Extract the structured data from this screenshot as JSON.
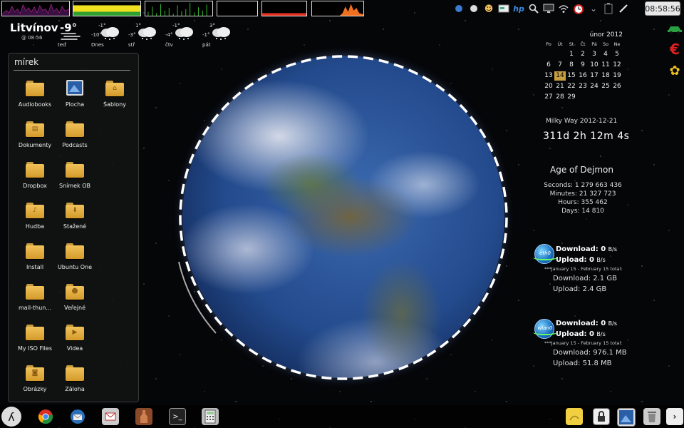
{
  "clock": "08:58:56",
  "monitors": [
    {
      "name": "cpu-graph",
      "color": "#e030c0"
    },
    {
      "name": "memory-graph",
      "color": "#f0e020"
    },
    {
      "name": "network-graph",
      "color": "#30c030"
    },
    {
      "name": "empty-graph",
      "color": "#ffffff"
    },
    {
      "name": "disk-graph",
      "color": "#e03020"
    },
    {
      "name": "load-graph",
      "color": "#f07020"
    }
  ],
  "tray_icons": [
    "blue-dot-icon",
    "white-dot-icon",
    "person-icon",
    "drive-icon",
    "hp-icon",
    "search-icon",
    "monitor-icon",
    "wifi-icon",
    "alarm-clock-icon",
    "chevron-icon",
    "battery-icon",
    "pen-icon"
  ],
  "weather": {
    "city": "Litvínov",
    "temp": "-9°",
    "updated": "@ 08:56",
    "now_label": "teď",
    "forecast": [
      {
        "day": "Dnes",
        "hi": "-1°",
        "lo": "-10°"
      },
      {
        "day": "stř",
        "hi": "1°",
        "lo": "-3°"
      },
      {
        "day": "čtv",
        "hi": "-1°",
        "lo": "-4°"
      },
      {
        "day": "pát",
        "hi": "3°",
        "lo": "-1°"
      }
    ]
  },
  "folder_panel": {
    "title": "mírek",
    "items": [
      {
        "label": "Audiobooks",
        "icon": "folder-icon"
      },
      {
        "label": "Plocha",
        "icon": "desktop-icon"
      },
      {
        "label": "Šablony",
        "icon": "templates-folder-icon"
      },
      {
        "label": "Dokumenty",
        "icon": "documents-folder-icon"
      },
      {
        "label": "Podcasts",
        "icon": "folder-icon"
      },
      {
        "label": "",
        "icon": ""
      },
      {
        "label": "Dropbox",
        "icon": "folder-icon"
      },
      {
        "label": "Snímek OB",
        "icon": "folder-icon"
      },
      {
        "label": "",
        "icon": ""
      },
      {
        "label": "Hudba",
        "icon": "music-folder-icon"
      },
      {
        "label": "Stažené",
        "icon": "downloads-folder-icon"
      },
      {
        "label": "",
        "icon": ""
      },
      {
        "label": "Install",
        "icon": "folder-icon"
      },
      {
        "label": "Ubuntu One",
        "icon": "folder-icon"
      },
      {
        "label": "",
        "icon": ""
      },
      {
        "label": "mail-thun...",
        "icon": "folder-icon"
      },
      {
        "label": "Veřejné",
        "icon": "public-folder-icon"
      },
      {
        "label": "",
        "icon": ""
      },
      {
        "label": "My ISO Files",
        "icon": "folder-icon"
      },
      {
        "label": "Videa",
        "icon": "videos-folder-icon"
      },
      {
        "label": "",
        "icon": ""
      },
      {
        "label": "Obrázky",
        "icon": "pictures-folder-icon"
      },
      {
        "label": "Záloha",
        "icon": "folder-icon"
      }
    ]
  },
  "calendar": {
    "title": "únor 2012",
    "day_headers": [
      "Po",
      "Út",
      "St",
      "Čt",
      "Pá",
      "So",
      "Ne"
    ],
    "days": [
      "",
      "",
      "1",
      "2",
      "3",
      "4",
      "5",
      "6",
      "7",
      "8",
      "9",
      "10",
      "11",
      "12",
      "13",
      "14",
      "15",
      "16",
      "17",
      "18",
      "19",
      "20",
      "21",
      "22",
      "23",
      "24",
      "25",
      "26",
      "27",
      "28",
      "29"
    ],
    "today": "14"
  },
  "countdown": {
    "label": "Milky Way 2012-12-21",
    "value": "311d 2h 12m 4s"
  },
  "age": {
    "title": "Age of Dejmon",
    "seconds": "Seconds: 1 279 663 436",
    "minutes": "Minutes: 21 327 723",
    "hours": "Hours: 355 462",
    "days": "Days: 14 810"
  },
  "network": [
    {
      "iface": "eth0",
      "download_label": "Download: 0",
      "upload_label": "Upload: 0",
      "unit": "B/s",
      "range": "***January 15 - February 15 total:",
      "total_download": "Download: 2.1 GB",
      "total_upload": "Upload: 2.4 GB"
    },
    {
      "iface": "wlan0",
      "download_label": "Download: 0",
      "upload_label": "Upload: 0",
      "unit": "B/s",
      "range": "***January 15 - February 15 total:",
      "total_download": "Download: 976.1 MB",
      "total_upload": "Upload: 51.8 MB"
    }
  ],
  "edge_icons": [
    "car-icon",
    "euro-icon",
    "flower-icon"
  ],
  "taskbar": {
    "left": [
      "gnome-foot-icon",
      "chrome-icon",
      "thunderbird-icon",
      "mail-icon",
      "bottle-icon",
      "terminal-icon",
      "calculator-icon"
    ],
    "right": [
      "notes-icon",
      "lock-icon",
      "desktop-icon",
      "trash-icon",
      "arrow-icon"
    ]
  }
}
